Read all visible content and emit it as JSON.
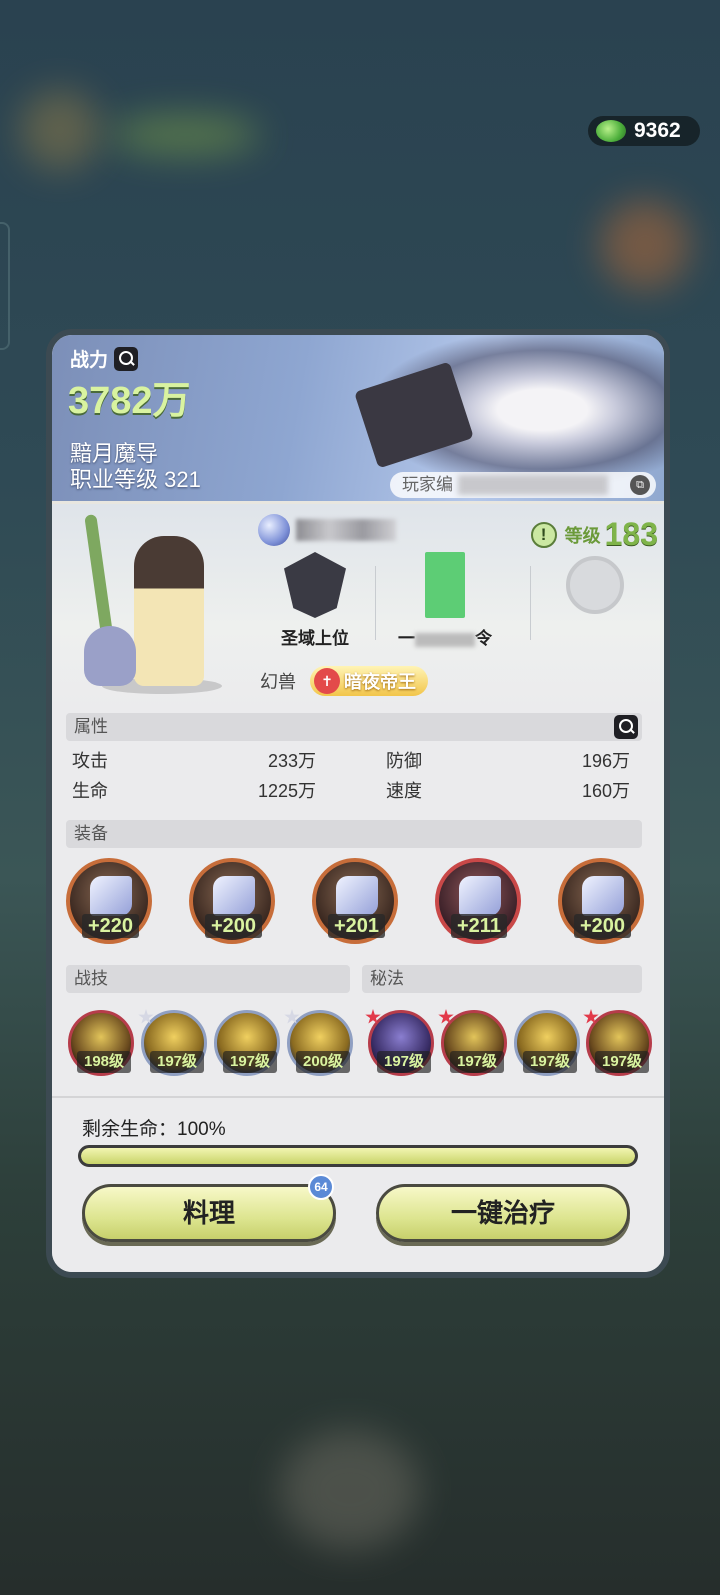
{
  "top_bar": {
    "currency_value": "9362",
    "currency_icon": "green-gem-icon"
  },
  "profile": {
    "power_label": "战力",
    "power_value": "3782万",
    "job_name": "黯月魔导",
    "job_level": "职业等级 321",
    "player_tag_prefix": "玩家编",
    "level_label": "等级",
    "level_value": "183",
    "badge1_label": "圣域上位",
    "badge2_label_prefix": "一",
    "badge2_label_suffix": "令",
    "pet_label": "幻兽",
    "pet_name": "暗夜帝王"
  },
  "attributes": {
    "title": "属性",
    "items": [
      {
        "name": "攻击",
        "value": "233万"
      },
      {
        "name": "防御",
        "value": "196万"
      },
      {
        "name": "生命",
        "value": "1225万"
      },
      {
        "name": "速度",
        "value": "160万"
      }
    ]
  },
  "equipment": {
    "title": "装备",
    "items": [
      {
        "bonus": "+220",
        "frame": "orange"
      },
      {
        "bonus": "+200",
        "frame": "orange"
      },
      {
        "bonus": "+201",
        "frame": "orange"
      },
      {
        "bonus": "+211",
        "frame": "red"
      },
      {
        "bonus": "+200",
        "frame": "orange"
      }
    ]
  },
  "skills": {
    "combat_title": "战技",
    "secret_title": "秘法",
    "items": [
      {
        "level": "198级"
      },
      {
        "level": "197级"
      },
      {
        "level": "197级"
      },
      {
        "level": "200级"
      },
      {
        "level": "197级",
        "badge": "S"
      },
      {
        "level": "197级"
      },
      {
        "level": "197级"
      },
      {
        "level": "197级"
      }
    ]
  },
  "status": {
    "hp_label": "剩余生命：100%",
    "hp_percent": 100
  },
  "actions": {
    "cook_label": "料理",
    "cook_badge": "64",
    "heal_label": "一键治疗"
  }
}
